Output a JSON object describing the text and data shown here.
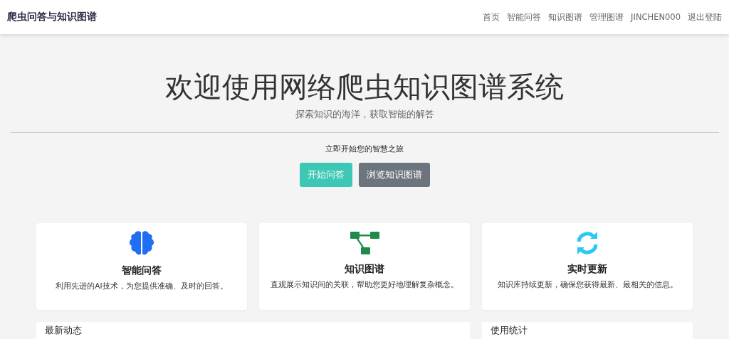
{
  "navbar": {
    "brand": "爬虫问答与知识图谱",
    "links": [
      {
        "label": "首页"
      },
      {
        "label": "智能问答"
      },
      {
        "label": "知识图谱"
      },
      {
        "label": "管理图谱"
      },
      {
        "label": "JINCHEN000"
      },
      {
        "label": "退出登陆"
      }
    ]
  },
  "hero": {
    "title": "欢迎使用网络爬虫知识图谱系统",
    "subtitle": "探索知识的海洋，获取智能的解答",
    "prompt": "立即开始您的智慧之旅",
    "buttons": [
      {
        "label": "开始问答",
        "kind": "primary"
      },
      {
        "label": "浏览知识图谱",
        "kind": "secondary"
      }
    ]
  },
  "features": [
    {
      "kind": "brain",
      "title": "智能问答",
      "text": "利用先进的AI技术，为您提供准确、及时的回答。"
    },
    {
      "kind": "graph",
      "title": "知识图谱",
      "text": "直观展示知识间的关联，帮助您更好地理解复杂概念。"
    },
    {
      "kind": "sync",
      "title": "实时更新",
      "text": "知识库持续更新，确保您获得最新、最相关的信息。"
    }
  ],
  "panels": [
    {
      "title": "最新动态"
    },
    {
      "title": "使用统计"
    }
  ]
}
